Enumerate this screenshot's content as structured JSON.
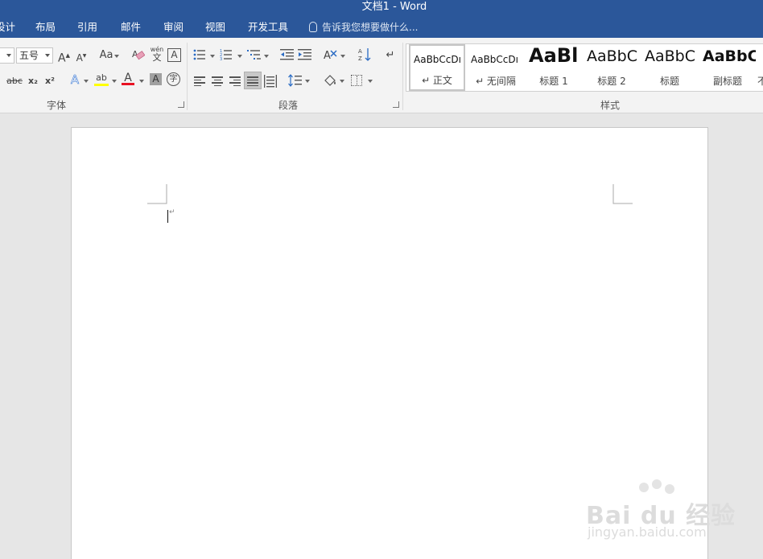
{
  "app": {
    "title": "文档1 - Word"
  },
  "tabs": [
    {
      "label": "设计"
    },
    {
      "label": "布局"
    },
    {
      "label": "引用"
    },
    {
      "label": "邮件"
    },
    {
      "label": "审阅"
    },
    {
      "label": "视图"
    },
    {
      "label": "开发工具"
    }
  ],
  "tell_me": {
    "text": "告诉我您想要做什么..."
  },
  "font_group": {
    "label": "字体",
    "font_size_value": "五号",
    "grow_font": "A",
    "shrink_font": "A",
    "change_case": "Aa",
    "phonetic_top": "wén",
    "phonetic_bottom": "文",
    "char_border": "A",
    "strikethrough": "abc",
    "subscript": "x₂",
    "superscript": "x²",
    "text_effects": "A",
    "highlight": "ab",
    "font_color": "A",
    "char_shading": "A",
    "enclose_char": "字"
  },
  "paragraph_group": {
    "label": "段落",
    "sort": "↓",
    "show_marks": "↵"
  },
  "styles_group": {
    "label": "样式",
    "items": [
      {
        "sample": "AaBbCcDı",
        "name": "↵ 正文"
      },
      {
        "sample": "AaBbCcDı",
        "name": "↵ 无间隔"
      },
      {
        "sample": "AaBl",
        "name": "标题 1"
      },
      {
        "sample": "AaBbC",
        "name": "标题 2"
      },
      {
        "sample": "AaBbC",
        "name": "标题"
      },
      {
        "sample": "AaBbC",
        "name": "副标题"
      },
      {
        "sample": "",
        "name": "不"
      }
    ]
  },
  "document": {
    "paragraph_mark": "↵"
  },
  "watermark": {
    "brand": "Bai  du 经验",
    "url": "jingyan.baidu.com"
  },
  "colors": {
    "title_bar": "#2b579a",
    "highlight_yellow": "#ffff00",
    "font_color_red": "#e81123"
  }
}
